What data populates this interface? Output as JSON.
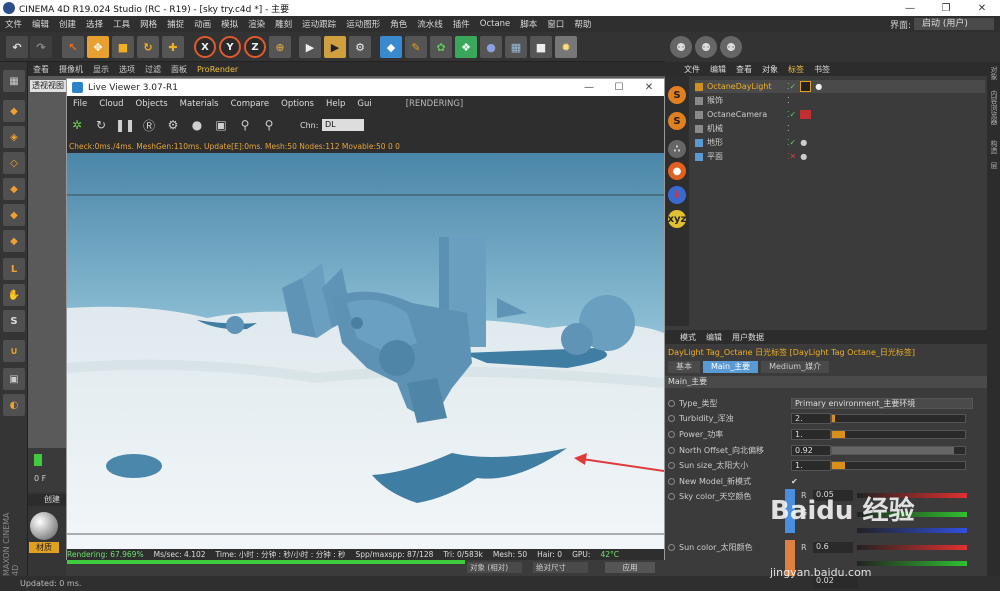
{
  "titlebar": {
    "title": "CINEMA 4D R19.024 Studio (RC - R19) - [sky try.c4d *] - 主要",
    "min": "—",
    "max": "❐",
    "close": "✕"
  },
  "menubar": {
    "items": [
      "文件",
      "编辑",
      "创建",
      "选择",
      "工具",
      "网格",
      "捕捉",
      "动画",
      "模拟",
      "渲染",
      "雕刻",
      "运动跟踪",
      "运动图形",
      "角色",
      "流水线",
      "插件",
      "Octane",
      "脚本",
      "窗口",
      "帮助"
    ],
    "layout_label": "界面:",
    "layout_value": "启动 (用户)"
  },
  "toolbar": {
    "x_label": "X",
    "y_label": "Y",
    "z_label": "Z"
  },
  "viewport_menu": {
    "items": [
      "查看",
      "摄像机",
      "显示",
      "选项",
      "过滤",
      "面板"
    ],
    "prorender": "ProRender",
    "view_tab": "透视视图"
  },
  "live_viewer": {
    "title": "Live Viewer 3.07-R1",
    "menu": [
      "File",
      "Cloud",
      "Objects",
      "Materials",
      "Compare",
      "Options",
      "Help",
      "Gui"
    ],
    "status": "[RENDERING]",
    "chn_label": "Chn:",
    "chn_value": "DL",
    "info": "Check:0ms./4ms. MeshGen:110ms. Update[E]:0ms. Mesh:50 Nodes:112 Movable:50  0 0",
    "rendering": "Rendering: 67.969%",
    "ms_sec": "Ms/sec: 4.102",
    "time": "Time: 小时 : 分钟 : 秒/小时 : 分钟 : 秒",
    "spp": "Spp/maxspp: 87/128",
    "tri": "Tri: 0/583k",
    "mesh": "Mesh: 50",
    "hair": "Hair: 0",
    "gpu": "GPU:",
    "temp": "42°C",
    "progress": 0.6797
  },
  "objects": {
    "menu": [
      "文件",
      "编辑",
      "查看",
      "对象",
      "标签",
      "书签"
    ],
    "active_menu": "标签",
    "items": [
      {
        "name": "OctaneDayLight",
        "selected": true
      },
      {
        "name": "猴饰",
        "selected": false
      },
      {
        "name": "OctaneCamera",
        "selected": false
      },
      {
        "name": "机械",
        "selected": false
      },
      {
        "name": "地形",
        "selected": false
      },
      {
        "name": "平面",
        "selected": false
      }
    ]
  },
  "attributes": {
    "menu": [
      "模式",
      "编辑",
      "用户数据"
    ],
    "title": "DayLight Tag_Octane 日光标签 [DayLight Tag Octane_日光标签]",
    "tabs": [
      "基本",
      "Main_主要",
      "Medium_媒介"
    ],
    "active_tab": "Main_主要",
    "section": "Main_主要",
    "params": [
      {
        "label": "Type_类型",
        "value": "Primary environment_主要环境"
      },
      {
        "label": "Turbidity_浑浊",
        "value": "2.",
        "fill": 0.02
      },
      {
        "label": "Power_功率",
        "value": "1.",
        "fill": 0.1
      },
      {
        "label": "North Offset_向北偏移",
        "value": "0.92",
        "fill": 0.92
      },
      {
        "label": "Sun size_太阳大小",
        "value": "1.",
        "fill": 0.1
      },
      {
        "label": "New Model_新模式",
        "value": "✔"
      },
      {
        "label": "Sky color_天空颜色",
        "value": ""
      },
      {
        "label": "Sun color_太阳颜色",
        "value": ""
      }
    ],
    "sky_r": "0.05",
    "sky_g": "G",
    "sun_r": "0.6",
    "sun_b": "0.02",
    "r_label": "R",
    "b_label": "B"
  },
  "bottom": {
    "create": "创建",
    "material": "材质",
    "frame": "0 F",
    "frame_field": "0",
    "object_drop": "对象 (相对)",
    "size_drop": "绝对尺寸",
    "apply": "应用",
    "status": "Updated: 0 ms."
  },
  "right_strip": [
    "对象",
    "内容浏览器",
    "构造",
    "层"
  ],
  "watermark": {
    "line1": "Baidu 经验",
    "line2": "jingyan.baidu.com"
  },
  "colors": {
    "accent": "#f0b020",
    "progress": "#3ecb3e",
    "arrow": "#e03a3a",
    "sky_top": "#4a86a8"
  }
}
